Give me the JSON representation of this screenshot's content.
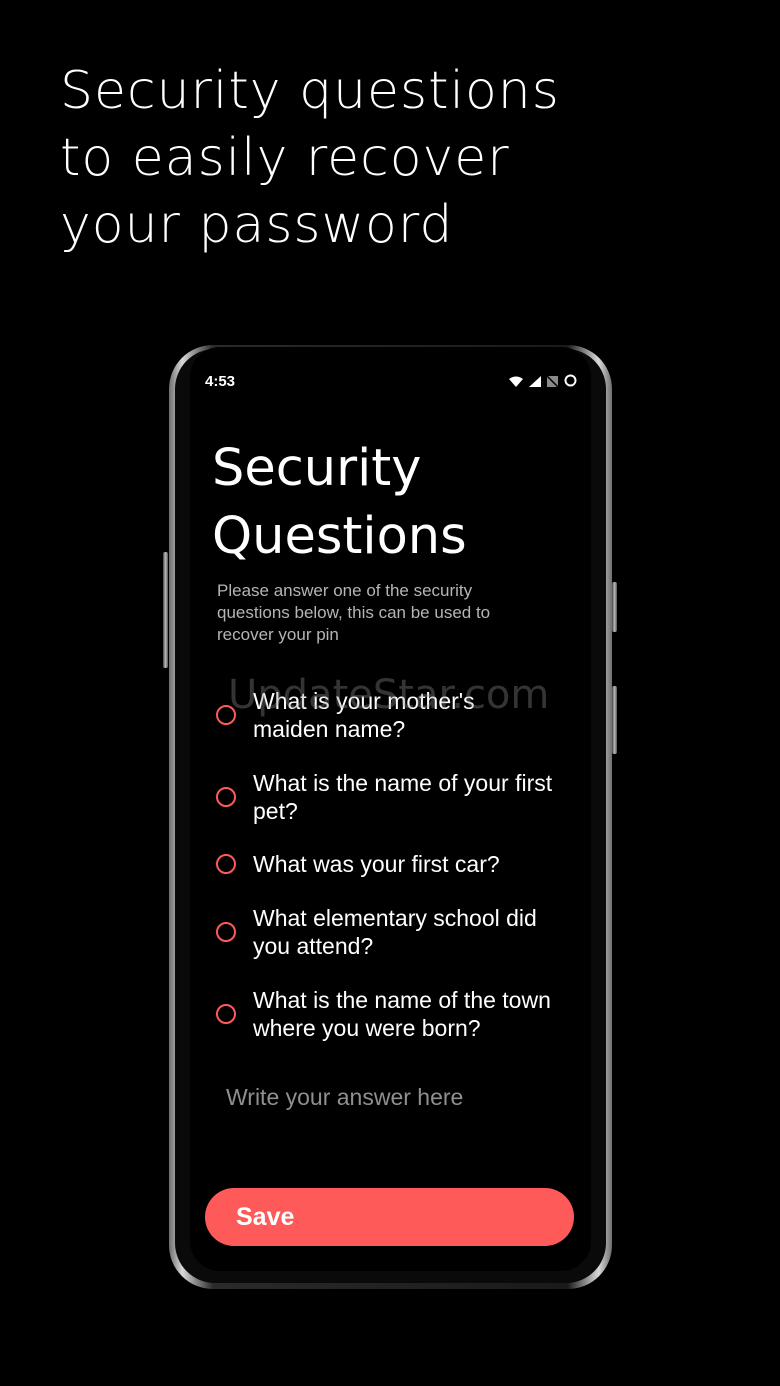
{
  "headline": {
    "lines": [
      "Security questions",
      "to easily recover",
      "your password"
    ]
  },
  "status_bar": {
    "time": "4:53",
    "icons": [
      "wifi-icon",
      "signal-icon",
      "no-sim-icon",
      "battery-ring-icon"
    ]
  },
  "screen": {
    "title_lines": [
      "Security",
      "Questions"
    ],
    "subtitle": "Please answer one of the security questions below, this can be used to recover your pin",
    "questions": [
      "What is your mother's maiden name?",
      "What is the name of your first pet?",
      "What was your first car?",
      "What elementary school did you attend?",
      "What is the name of the town where you were born?"
    ],
    "answer_placeholder": "Write your answer here",
    "save_label": "Save"
  },
  "watermark": "UpdateStar.com",
  "colors": {
    "accent": "#ff5a5a",
    "background": "#000000",
    "text": "#ffffff",
    "muted_text": "#b5b5b5",
    "placeholder": "#8f8f8f"
  }
}
